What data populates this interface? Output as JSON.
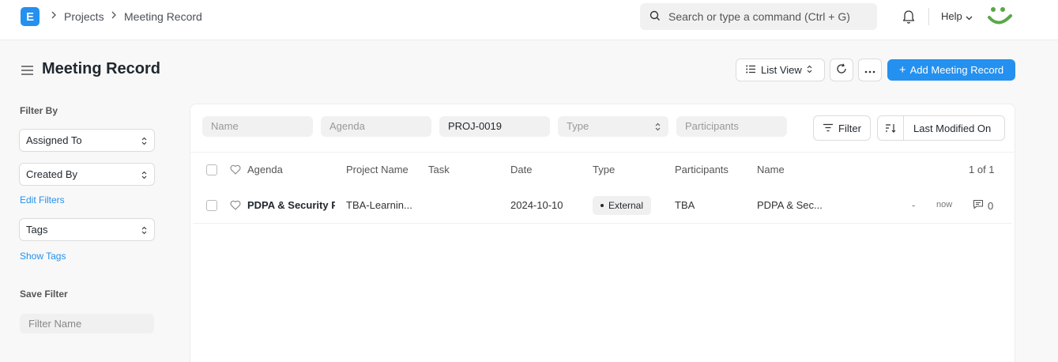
{
  "navbar": {
    "logo_letter": "E",
    "breadcrumbs": [
      "Projects",
      "Meeting Record"
    ],
    "search_placeholder": "Search or type a command (Ctrl + G)",
    "help_label": "Help"
  },
  "page": {
    "title": "Meeting Record",
    "list_view_label": "List View",
    "add_button_label": "Add Meeting Record",
    "accent_color": "#2490ef"
  },
  "sidebar": {
    "filter_by_label": "Filter By",
    "assigned_to_label": "Assigned To",
    "created_by_label": "Created By",
    "edit_filters_label": "Edit Filters",
    "tags_label": "Tags",
    "show_tags_label": "Show Tags",
    "save_filter_label": "Save Filter",
    "filter_name_placeholder": "Filter Name"
  },
  "filters": {
    "name_placeholder": "Name",
    "agenda_placeholder": "Agenda",
    "project_value": "PROJ-0019",
    "type_placeholder": "Type",
    "participants_placeholder": "Participants",
    "filter_button_label": "Filter",
    "sort_label": "Last Modified On"
  },
  "table": {
    "columns": [
      "Agenda",
      "Project Name",
      "Task",
      "Date",
      "Type",
      "Participants",
      "Name"
    ],
    "count_label": "1 of 1",
    "rows": [
      {
        "agenda": "PDPA & Security Pr",
        "project_name": "TBA-Learnin...",
        "task": "",
        "date": "2024-10-10",
        "type": "External",
        "participants": "TBA",
        "name": "PDPA & Sec...",
        "dash": "-",
        "modified": "now",
        "comments": "0"
      }
    ]
  }
}
